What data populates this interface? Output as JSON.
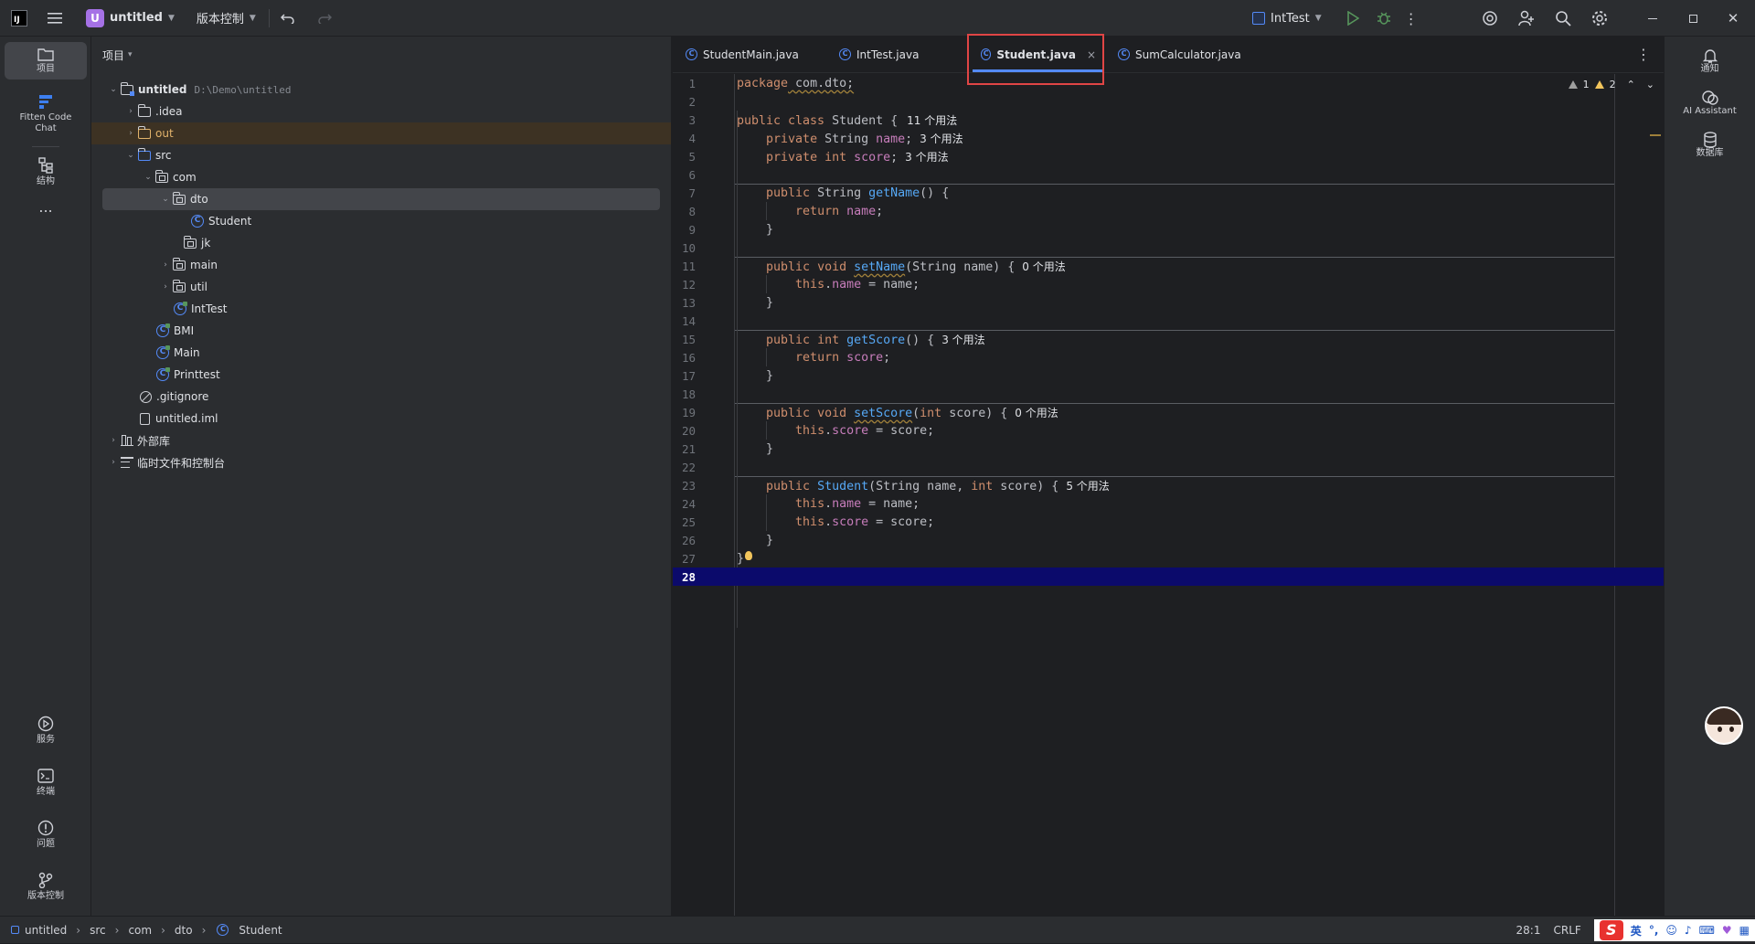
{
  "titlebar": {
    "logo": "IJ",
    "project_badge": "U",
    "project_name": "untitled",
    "vcs_label": "版本控制",
    "run_config": "IntTest"
  },
  "left_strip": {
    "items": [
      {
        "label": "项目",
        "icon": "folder-icon"
      },
      {
        "label": "Fitten Code Chat",
        "icon": "fitten-icon"
      },
      {
        "label": "结构",
        "icon": "structure-icon"
      },
      {
        "label": "...",
        "icon": "more-icon"
      }
    ],
    "bottom_items": [
      {
        "label": "服务",
        "icon": "services-icon"
      },
      {
        "label": "终端",
        "icon": "terminal-icon"
      },
      {
        "label": "问题",
        "icon": "problems-icon"
      },
      {
        "label": "版本控制",
        "icon": "vcs-icon"
      }
    ]
  },
  "project_panel": {
    "header": "项目",
    "tree": [
      {
        "label": "untitled",
        "hint": "D:\\Demo\\untitled"
      },
      {
        "label": ".idea"
      },
      {
        "label": "out"
      },
      {
        "label": "src"
      },
      {
        "label": "com"
      },
      {
        "label": "dto"
      },
      {
        "label": "Student"
      },
      {
        "label": "jk"
      },
      {
        "label": "main"
      },
      {
        "label": "util"
      },
      {
        "label": "IntTest"
      },
      {
        "label": "BMI"
      },
      {
        "label": "Main"
      },
      {
        "label": "Printtest"
      },
      {
        "label": ".gitignore"
      },
      {
        "label": "untitled.iml"
      },
      {
        "label": "外部库"
      },
      {
        "label": "临时文件和控制台"
      }
    ]
  },
  "tabs": [
    {
      "label": "StudentMain.java"
    },
    {
      "label": "IntTest.java"
    },
    {
      "label": "Student.java",
      "close": "×"
    },
    {
      "label": "SumCalculator.java"
    }
  ],
  "inspections": {
    "weak_warnings": "1",
    "warnings": "2"
  },
  "code": {
    "line_numbers": [
      "1",
      "2",
      "3",
      "4",
      "5",
      "6",
      "7",
      "8",
      "9",
      "10",
      "11",
      "12",
      "13",
      "14",
      "15",
      "16",
      "17",
      "18",
      "19",
      "20",
      "21",
      "22",
      "23",
      "24",
      "25",
      "26",
      "27",
      "28"
    ],
    "l1_kw": "package",
    "l1_rest": " com.dto;",
    "l3_kw": "public class",
    "l3_name": "Student",
    "l3_rest": " {",
    "l3_hint": "11 个用法",
    "l4_kw": "private",
    "l4_type": " String ",
    "l4_field": "name",
    "l4_rest": ";",
    "l4_hint": "3 个用法",
    "l5_kw": "private int",
    "l5_field": "score",
    "l5_rest": ";",
    "l5_hint": "3 个用法",
    "l7_kw": "public",
    "l7_type": " String ",
    "l7_fn": "getName",
    "l7_rest": "() {",
    "l8_kw": "return",
    "l8_field": "name",
    "l8_rest": ";",
    "close_brace": "}",
    "l11_kw": "public void",
    "l11_fn": "setName",
    "l11_rest": "(String name) {",
    "l11_hint": "0 个用法",
    "l12_kw": "this",
    "l12_field": "name",
    "l12_rest": " = name;",
    "l15_kw": "public int",
    "l15_fn": "getScore",
    "l15_rest": "() {",
    "l15_hint": "3 个用法",
    "l16_kw": "return",
    "l16_field": "score",
    "l16_rest": ";",
    "l19_kw": "public void",
    "l19_fn": "setScore",
    "l19_open": "(",
    "l19_kw2": "int",
    "l19_rest": " score) {",
    "l19_hint": "0 个用法",
    "l20_kw": "this",
    "l20_field": "score",
    "l20_rest": " = score;",
    "l23_kw": "public",
    "l23_fn": "Student",
    "l23_mid": "(String name, ",
    "l23_kw2": "int",
    "l23_rest": " score) {",
    "l23_hint": "5 个用法",
    "l24_kw": "this",
    "l24_field": "name",
    "l24_rest": " = name;",
    "l25_kw": "this",
    "l25_field": "score",
    "l25_rest": " = score;"
  },
  "right_strip": [
    {
      "label": "通知",
      "icon": "bell-icon"
    },
    {
      "label": "AI Assistant",
      "icon": "ai-assistant-icon"
    },
    {
      "label": "数据库",
      "icon": "database-icon"
    }
  ],
  "statusbar": {
    "breadcrumb": [
      "untitled",
      "src",
      "com",
      "dto",
      "Student"
    ],
    "position": "28:1",
    "line_ending": "CRLF",
    "ime_lang": "英"
  }
}
